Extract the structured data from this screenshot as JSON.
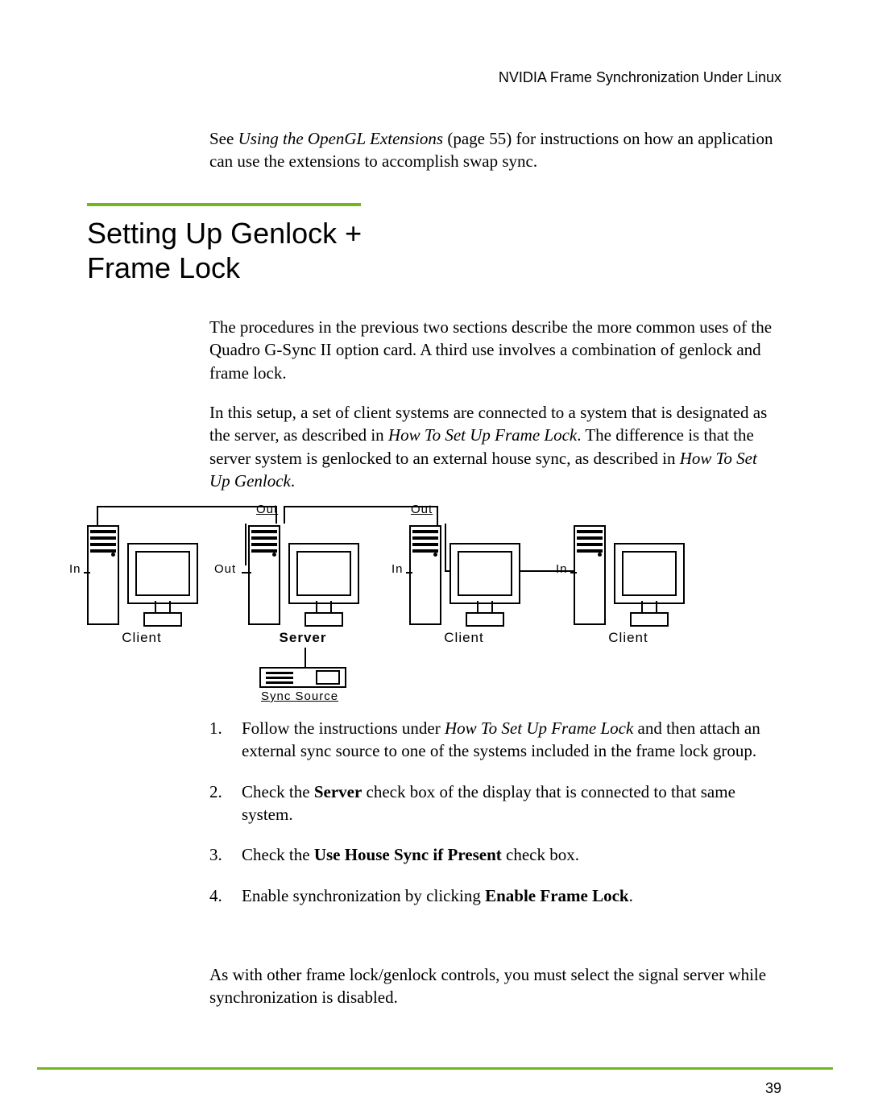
{
  "runningHead": "NVIDIA Frame Synchronization Under Linux",
  "intro": {
    "pre": "See ",
    "ref": "Using the OpenGL Extensions",
    "post": " (page 55) for instructions on how an application can use the extensions to accomplish swap sync."
  },
  "sectionTitle": {
    "line1": "Setting Up Genlock +",
    "line2": "Frame Lock"
  },
  "para1": "The procedures in the previous two sections describe the more common uses of the Quadro G-Sync II option card. A third use involves a combination of genlock and frame lock.",
  "para2": {
    "a": "In this setup, a set of client systems are connected to a system that is designated as the server, as described in ",
    "i1": "How To Set Up Frame Lock",
    "b": ". The difference is that the server system is genlocked to an external house sync, as described in ",
    "i2": "How To Set Up Genlock",
    "c": "."
  },
  "diagram": {
    "labels": {
      "client": "Client",
      "server": "Server",
      "in": "In",
      "out": "Out",
      "syncSource": "Sync Source"
    }
  },
  "list": {
    "item1": {
      "num": "1.",
      "a": "Follow the instructions under ",
      "i": "How To Set Up Frame Lock",
      "b": " and then attach an external sync source to one of the systems included in the frame lock group."
    },
    "item2": {
      "num": "2.",
      "a": "Check the ",
      "bold": "Server",
      "b": " check box of the display that is connected to that same system."
    },
    "item3": {
      "num": "3.",
      "a": "Check the ",
      "bold": "Use House Sync if Present",
      "b": " check box."
    },
    "item4": {
      "num": "4.",
      "a": "Enable synchronization by clicking ",
      "bold": "Enable Frame Lock",
      "b": "."
    }
  },
  "closing": "As with other frame lock/genlock controls, you must select the signal server while synchronization is disabled.",
  "pageNumber": "39"
}
